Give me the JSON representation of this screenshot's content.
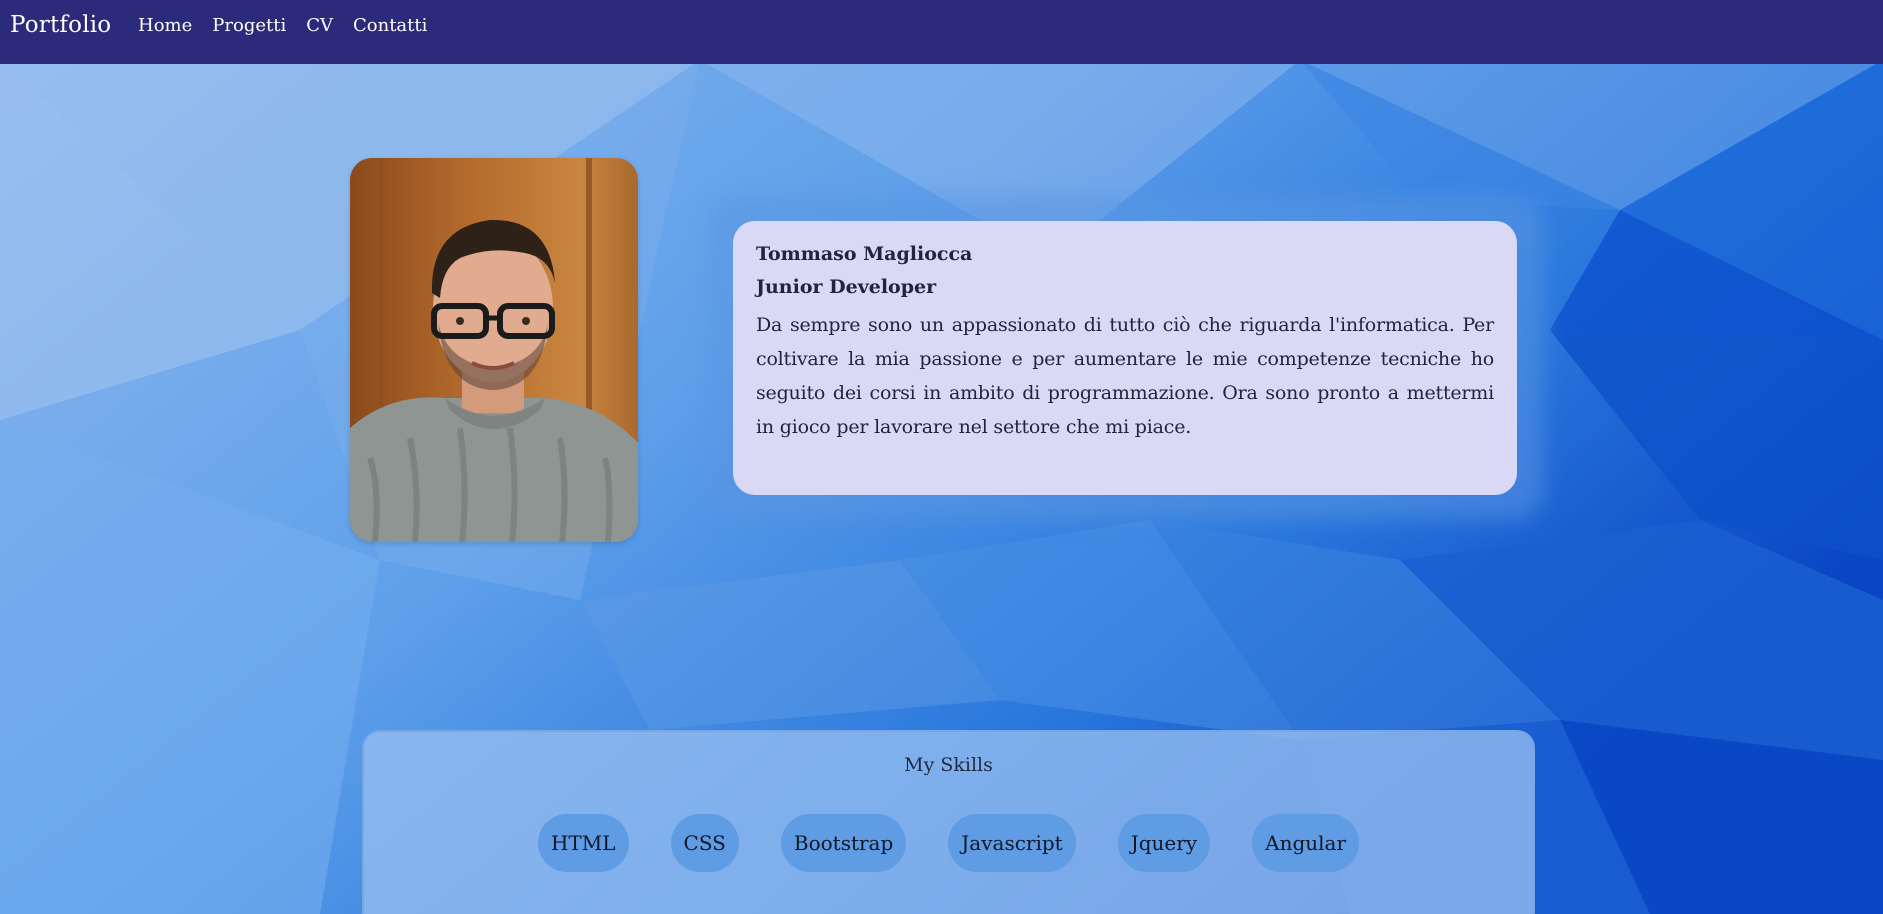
{
  "nav": {
    "brand": "Portfolio",
    "links": [
      "Home",
      "Progetti",
      "CV",
      "Contatti"
    ]
  },
  "profile": {
    "photo_alt": "profile photo",
    "name": "Tommaso Magliocca",
    "role": "Junior Developer",
    "bio": "Da sempre sono un appassionato di tutto ciò che riguarda l'informatica. Per coltivare la mia passione e per aumentare le mie competenze tecniche ho seguito dei corsi in ambito di programmazione. Ora sono pronto a mettermi in gioco per lavorare nel settore che mi piace."
  },
  "skills": {
    "title": "My Skills",
    "items": [
      "HTML",
      "CSS",
      "Bootstrap",
      "Javascript",
      "Jquery",
      "Angular"
    ]
  },
  "colors": {
    "navbar": "#2c2b7b",
    "bio_card": "#d9d9f6",
    "skill_pill": "#5f9ce3",
    "background": "#6fa6ec"
  }
}
